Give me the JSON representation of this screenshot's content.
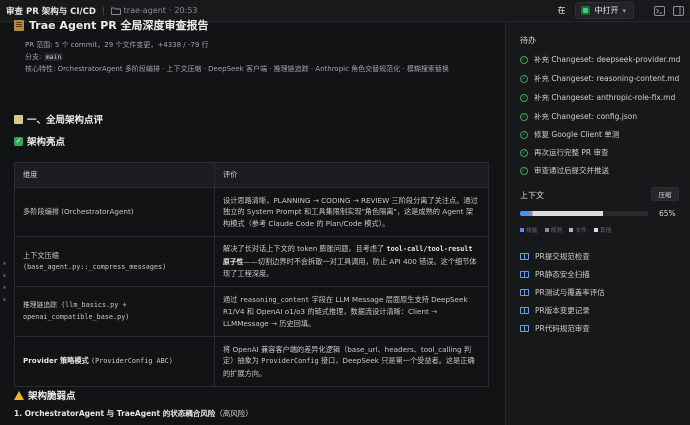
{
  "topbar": {
    "title": "审查 PR 架构与 CI/CD",
    "folder": "trae-agent",
    "time": "20:53",
    "in_label": "在",
    "open_label": "中打开"
  },
  "report": {
    "title": "Trae Agent PR 全局深度审查报告",
    "scope": "PR 范围: 5 个 commit，29 个文件变更，+4338 / -79 行",
    "branch_label": "分支:",
    "branch_value": "main",
    "features": "核心特性: OrchestratorAgent 多阶段编排 · 上下文压缩 · DeepSeek 客户端 · 推理链追踪 · Anthropic 角色交替规范化 · 模糊搜索替换"
  },
  "section1": "一、全局架构点评",
  "highlights": "架构亮点",
  "table": {
    "headers": [
      "维度",
      "评价"
    ],
    "rows": [
      {
        "dim": "多阶段编排 (OrchestratorAgent)",
        "eval": "设计思路清晰，PLANNING → CODING → REVIEW 三阶段分离了关注点。通过独立的 System Prompt 和工具集限制实现\"角色隔离\"，这是成熟的 Agent 架构模式（参考 Claude Code 的 Plan/Code 模式）。"
      },
      {
        "dim_a": "上下文压缩",
        "dim_b": "(base_agent.py::_compress_messages)",
        "eval_a": "解决了长对话上下文的 token 膨胀问题，且考虑了",
        "eval_b": "tool-call/tool-result 原子性",
        "eval_c": "——切割边界时不会拆散一对工具调用，防止 API 400 错误。这个细节体现了工程深度。"
      },
      {
        "dim": "推理链追踪 (llm_basics.py + openai_compatible_base.py)",
        "eval_a": "通过",
        "eval_b": "reasoning_content",
        "eval_c": "字段在 LLM Message 层面原生支持 DeepSeek R1/V4 和 OpenAI o1/o3 的链式推理，数据流设计清晰：Client → LLMMessage → 历史回填。"
      },
      {
        "dim_a": "Provider 策略模式",
        "dim_b": "(ProviderConfig ABC)",
        "eval_a": "将 OpenAI 兼容客户端的差异化逻辑（base_url、headers、tool_calling 判定）抽象为",
        "eval_b": "ProviderConfig",
        "eval_c": "接口，DeepSeek 只是第一个受益者。这是正确的扩展方向。"
      }
    ]
  },
  "weakness": "架构脆弱点",
  "risk": {
    "title": "1. OrchestratorAgent 与 TraeAgent 的状态耦合风险",
    "suffix": "（高风险）"
  },
  "sidebar": {
    "todo_title": "待办",
    "todos": [
      "补充 Changeset: deepseek-provider.md",
      "补充 Changeset: reasoning-content.md",
      "补充 Changeset: anthropic-role-fix.md",
      "补充 Changeset: config.json",
      "修复 Google Client 单测",
      "再次运行完整 PR 审查",
      "审查通过后提交并推送"
    ],
    "context_title": "上下文",
    "compress_label": "压缩",
    "context_percent": "65%",
    "context_segments": [
      {
        "name": "技能",
        "fraction": 0.07,
        "color": "#4f8ff7"
      },
      {
        "name": "规则",
        "fraction": 0.02,
        "color": "#8b8d92"
      },
      {
        "name": "文件",
        "fraction": 0.01,
        "color": "#b5b7bb"
      },
      {
        "name": "其他",
        "fraction": 0.55,
        "color": "#dcdcdc"
      }
    ],
    "skills": [
      "PR提交规范检查",
      "PR静态安全扫描",
      "PR测试与覆盖率评估",
      "PR版本变更记录",
      "PR代码规范审查"
    ]
  }
}
